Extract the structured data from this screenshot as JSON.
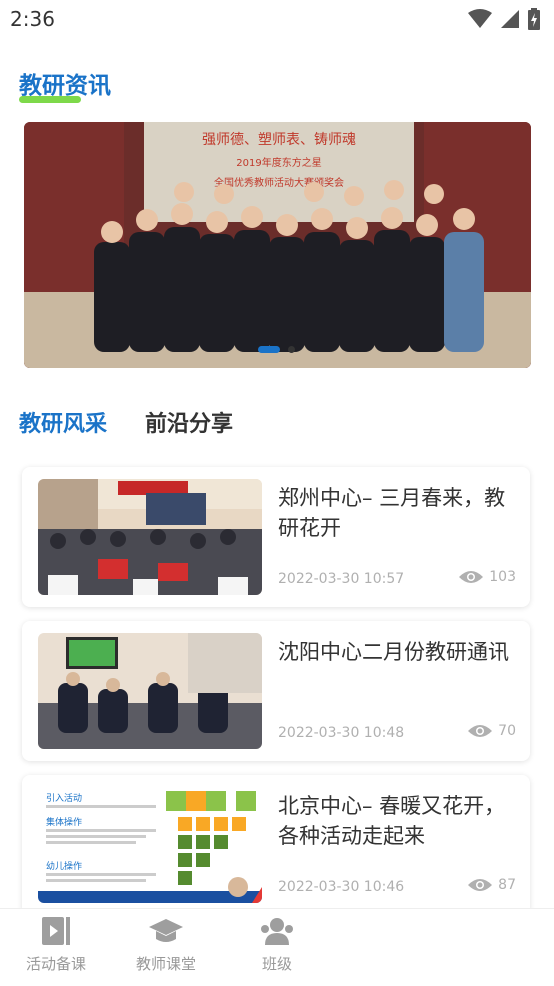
{
  "status": {
    "time": "2:36"
  },
  "section": {
    "title": "教研资讯"
  },
  "tabs": [
    {
      "label": "教研风采",
      "active": true
    },
    {
      "label": "前沿分享",
      "active": false
    }
  ],
  "articles": [
    {
      "title": "郑州中心– 三月春来，教研花开",
      "date": "2022-03-30 10:57",
      "views": "103"
    },
    {
      "title": "沈阳中心二月份教研通讯",
      "date": "2022-03-30 10:48",
      "views": "70"
    },
    {
      "title": "北京中心– 春暖又花开，各种活动走起来",
      "date": "2022-03-30 10:46",
      "views": "87"
    }
  ],
  "banner_text": {
    "line1": "强师德、塑师表、铸师魂",
    "line2": "2019年度东方之星",
    "line3": "全国优秀教师活动大赛颁奖会"
  },
  "slide_image_text": {
    "header1": "引入活动",
    "header2": "集体操作",
    "header3": "幼儿操作"
  },
  "nav": [
    {
      "label": "活动备课",
      "icon": "video-icon"
    },
    {
      "label": "教师课堂",
      "icon": "graduation-cap-icon"
    },
    {
      "label": "班级",
      "icon": "class-group-icon"
    }
  ],
  "colors": {
    "accent": "#1a73c8",
    "underline": "#7ed94a",
    "muted": "#b0b0b0"
  }
}
